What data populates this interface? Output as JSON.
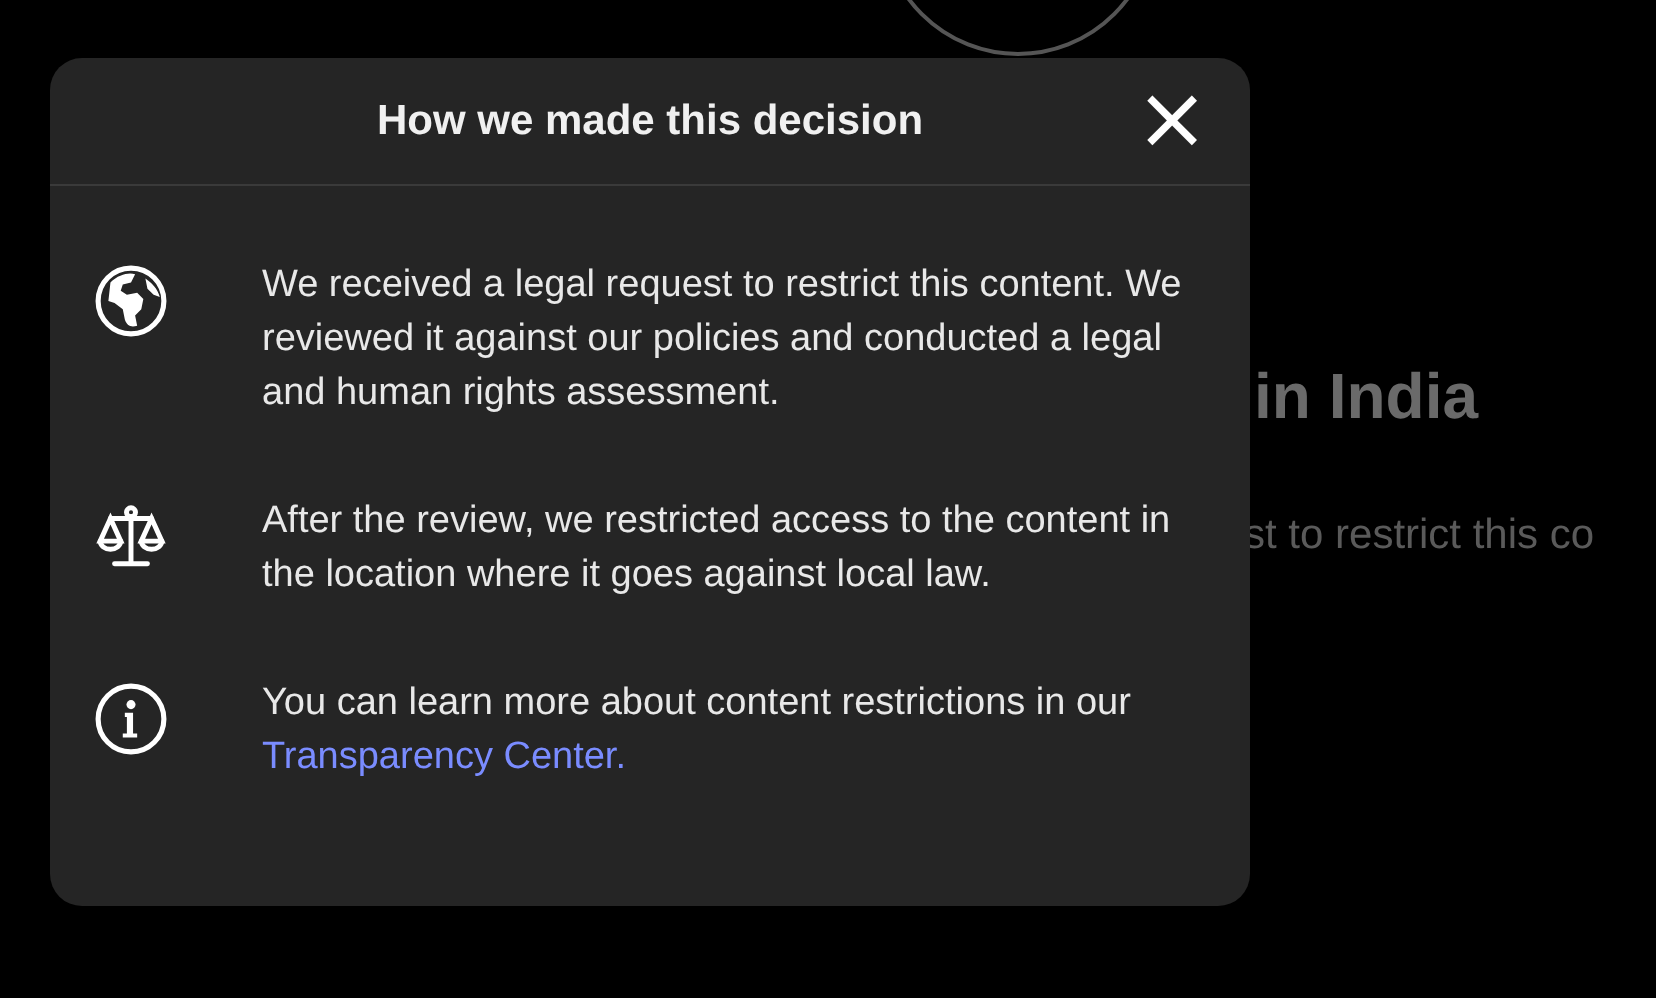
{
  "background": {
    "heading": "in India",
    "subtext": "st to restrict this co"
  },
  "dialog": {
    "title": "How we made this decision",
    "close": "×",
    "items": [
      {
        "kind": "globe",
        "text": "We received a legal request to restrict this content. We reviewed it against our policies and conducted a legal and human rights assessment."
      },
      {
        "kind": "scale",
        "text": "After the review, we restricted access to the content in the location where it goes against local law."
      },
      {
        "kind": "info",
        "text": "You can learn more about content restrictions in our",
        "link": "Transparency Center."
      }
    ]
  }
}
